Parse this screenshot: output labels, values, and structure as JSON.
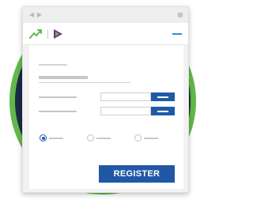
{
  "window": {
    "back_icon": "chevron-left-icon",
    "forward_icon": "chevron-right-icon",
    "back_glyph": "◀",
    "forward_glyph": "▶"
  },
  "appbar": {
    "logo_icons": [
      "trend-line-icon",
      "play-triangle-icon"
    ],
    "menu_icon": "hamburger-menu-icon",
    "colors": {
      "trend_green": "#62b84a",
      "play_green": "#62b84a",
      "play_purple": "#7b2a8c",
      "menu_blue": "#2d8fd6"
    }
  },
  "form": {
    "fields": [
      {
        "value": "",
        "button_icon": "dash-icon"
      },
      {
        "value": "",
        "button_icon": "dash-icon"
      }
    ],
    "radio_options": [
      {
        "checked": true
      },
      {
        "checked": false
      },
      {
        "checked": false
      }
    ],
    "register_label": "REGISTER",
    "colors": {
      "primary": "#2058a6",
      "ring": "#62b84a",
      "disc": "#1a2a45"
    }
  }
}
